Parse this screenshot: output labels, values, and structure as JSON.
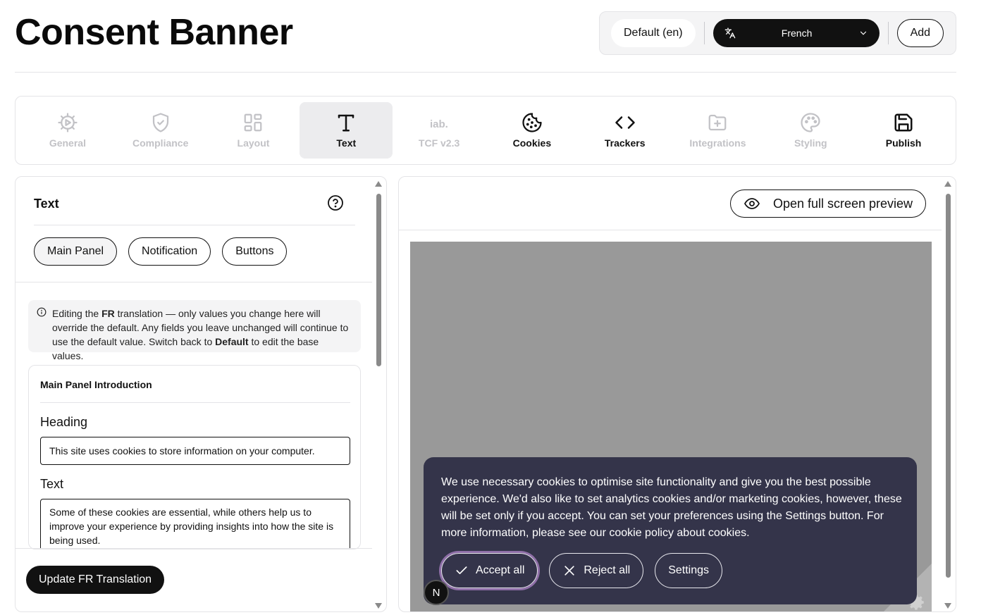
{
  "header": {
    "title": "Consent Banner",
    "default_lang": "Default (en)",
    "selected_lang": "French",
    "add_label": "Add"
  },
  "tabs": [
    {
      "label": "General",
      "icon": "gear-play-icon",
      "state": "disabled"
    },
    {
      "label": "Compliance",
      "icon": "shield-check-icon",
      "state": "disabled"
    },
    {
      "label": "Layout",
      "icon": "layout-grid-icon",
      "state": "disabled"
    },
    {
      "label": "Text",
      "icon": "text-icon",
      "state": "active"
    },
    {
      "label": "TCF v2.3",
      "icon": "iab-logo-icon",
      "state": "disabled"
    },
    {
      "label": "Cookies",
      "icon": "cookie-icon",
      "state": "enabled"
    },
    {
      "label": "Trackers",
      "icon": "code-brackets-icon",
      "state": "enabled"
    },
    {
      "label": "Integrations",
      "icon": "folder-plus-icon",
      "state": "disabled"
    },
    {
      "label": "Styling",
      "icon": "palette-icon",
      "state": "disabled"
    },
    {
      "label": "Publish",
      "icon": "save-icon",
      "state": "enabled"
    }
  ],
  "left_panel": {
    "heading": "Text",
    "pills": [
      "Main Panel",
      "Notification",
      "Buttons"
    ],
    "info": {
      "part1": "Editing the ",
      "bold1": "FR",
      "part2": " translation — only values you change here will override the default. Any fields you leave unchanged will continue to use the default value. Switch back to ",
      "bold2": "Default",
      "part3": " to edit the base values."
    },
    "section": {
      "title": "Main Panel Introduction",
      "heading_label": "Heading",
      "heading_value": "This site uses cookies to store information on your computer.",
      "text_label": "Text",
      "text_value": "Some of these cookies are essential, while others help us to improve your experience by providing insights into how the site is being used."
    },
    "update_button": "Update FR Translation"
  },
  "right_panel": {
    "preview_button": "Open full screen preview",
    "banner_text": "We use necessary cookies to optimise site functionality and give you the best possible experience. We'd also like to set analytics cookies and/or marketing cookies, however, these will be set only if you accept. You can set your preferences using the Settings button. For more information, please see our cookie policy about cookies.",
    "accept": "Accept all",
    "reject": "Reject all",
    "settings": "Settings",
    "badge": "N"
  },
  "colors": {
    "banner_bg": "#34344a",
    "preview_bg": "#999999",
    "accent": "#111111",
    "accept_ring": "#8f6fa8"
  }
}
